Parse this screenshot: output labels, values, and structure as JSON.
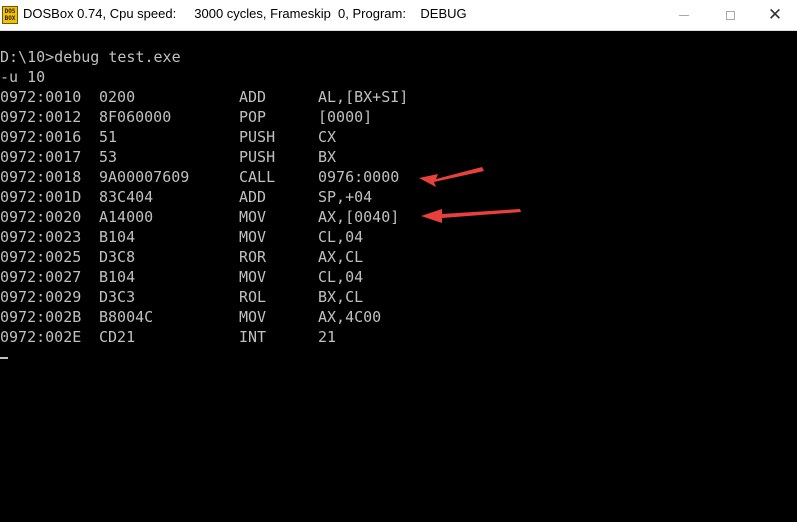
{
  "window": {
    "title": "DOSBox 0.74, Cpu speed:     3000 cycles, Frameskip  0, Program:    DEBUG",
    "icon_text": "DOS BOX"
  },
  "console": {
    "prompt_line": "D:\\10>debug test.exe",
    "command_line": "-u 10",
    "rows": [
      {
        "addr": "0972:0010",
        "hex": "0200",
        "mnemonic": "ADD",
        "operand": "AL,[BX+SI]"
      },
      {
        "addr": "0972:0012",
        "hex": "8F060000",
        "mnemonic": "POP",
        "operand": "[0000]"
      },
      {
        "addr": "0972:0016",
        "hex": "51",
        "mnemonic": "PUSH",
        "operand": "CX"
      },
      {
        "addr": "0972:0017",
        "hex": "53",
        "mnemonic": "PUSH",
        "operand": "BX"
      },
      {
        "addr": "0972:0018",
        "hex": "9A00007609",
        "mnemonic": "CALL",
        "operand": "0976:0000"
      },
      {
        "addr": "0972:001D",
        "hex": "83C404",
        "mnemonic": "ADD",
        "operand": "SP,+04"
      },
      {
        "addr": "0972:0020",
        "hex": "A14000",
        "mnemonic": "MOV",
        "operand": "AX,[0040]"
      },
      {
        "addr": "0972:0023",
        "hex": "B104",
        "mnemonic": "MOV",
        "operand": "CL,04"
      },
      {
        "addr": "0972:0025",
        "hex": "D3C8",
        "mnemonic": "ROR",
        "operand": "AX,CL"
      },
      {
        "addr": "0972:0027",
        "hex": "B104",
        "mnemonic": "MOV",
        "operand": "CL,04"
      },
      {
        "addr": "0972:0029",
        "hex": "D3C3",
        "mnemonic": "ROL",
        "operand": "BX,CL"
      },
      {
        "addr": "0972:002B",
        "hex": "B8004C",
        "mnemonic": "MOV",
        "operand": "AX,4C00"
      },
      {
        "addr": "0972:002E",
        "hex": "CD21",
        "mnemonic": "INT",
        "operand": "21"
      }
    ]
  },
  "colors": {
    "console_bg": "#000000",
    "console_text": "#c0c0c0",
    "annotation_arrow": "#e8403a"
  },
  "icons": [
    "dosbox-app-icon",
    "minimize-icon",
    "maximize-icon",
    "close-icon",
    "annotation-arrow-icon"
  ]
}
